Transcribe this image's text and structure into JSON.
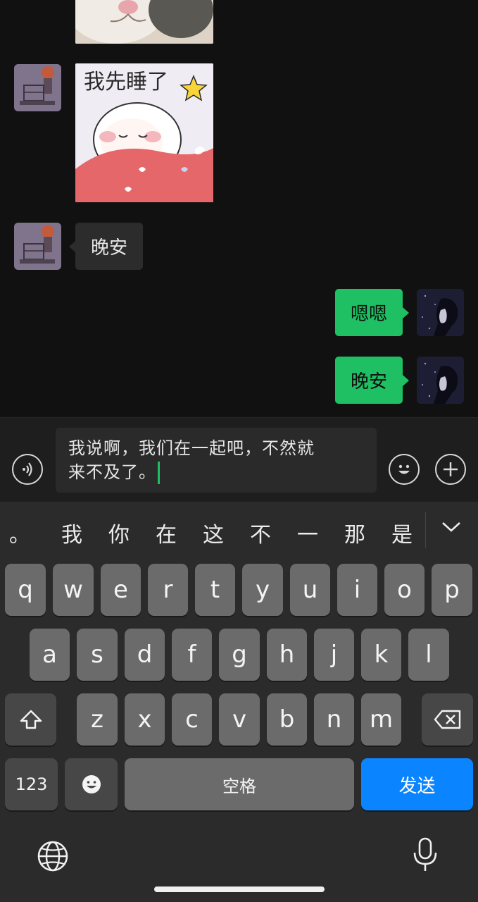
{
  "chat": {
    "messages": [
      {
        "sender": "other",
        "type": "sticker",
        "description": "cat"
      },
      {
        "sender": "other",
        "type": "sticker",
        "text": "我先睡了"
      },
      {
        "sender": "other",
        "type": "text",
        "text": "晚安"
      },
      {
        "sender": "self",
        "type": "text",
        "text": "嗯嗯"
      },
      {
        "sender": "self",
        "type": "text",
        "text": "晚安"
      }
    ]
  },
  "input_bar": {
    "voice_icon": "voice-wave-icon",
    "text_line1": "我说啊，我们在一起吧，不然就",
    "text_line2": "来不及了。",
    "emoji_icon": "smiley-icon",
    "plus_icon": "plus-circle-icon"
  },
  "keyboard": {
    "candidates": [
      "。",
      "我",
      "你",
      "在",
      "这",
      "不",
      "一",
      "那",
      "是"
    ],
    "collapse_icon": "chevron-down-icon",
    "row1": [
      "q",
      "w",
      "e",
      "r",
      "t",
      "y",
      "u",
      "i",
      "o",
      "p"
    ],
    "row2": [
      "a",
      "s",
      "d",
      "f",
      "g",
      "h",
      "j",
      "k",
      "l"
    ],
    "row3": [
      "z",
      "x",
      "c",
      "v",
      "b",
      "n",
      "m"
    ],
    "shift_icon": "shift-icon",
    "delete_icon": "backspace-icon",
    "numbers_label": "123",
    "emoji_key_icon": "emoji-icon",
    "space_label": "空格",
    "send_label": "发送",
    "globe_icon": "globe-icon",
    "mic_icon": "microphone-icon",
    "send_color": "#0a84ff",
    "bubble_self_color": "#1fbf63"
  }
}
